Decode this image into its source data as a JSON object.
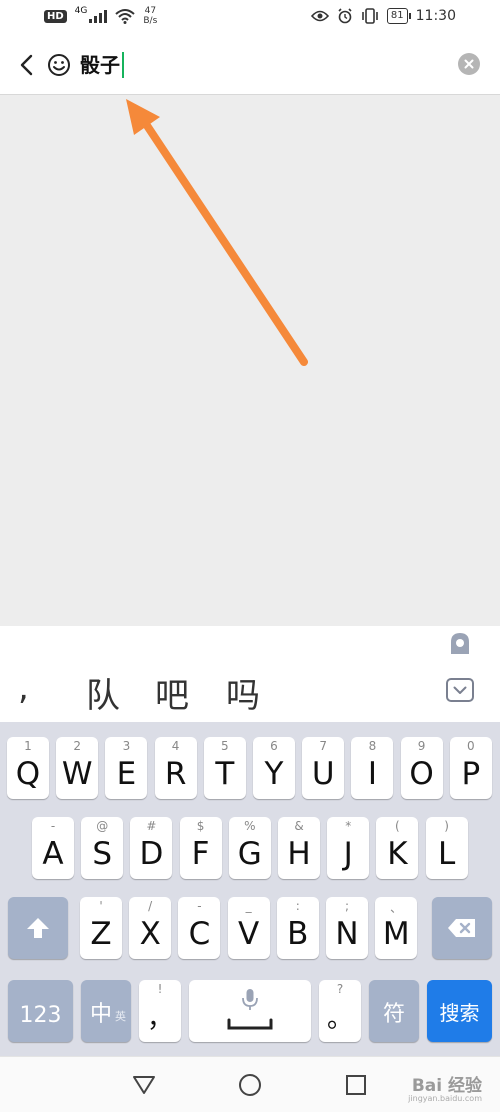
{
  "status_bar": {
    "badge": "HD",
    "network_type": "4G",
    "speed_value": "47",
    "speed_unit": "B/s",
    "battery": "81",
    "time": "11:30",
    "icons": [
      "eye-icon",
      "alarm-icon",
      "vibrate-icon",
      "battery-icon"
    ]
  },
  "search": {
    "query": "骰子",
    "back_icon": "chevron-left-icon",
    "emoji_icon": "smiley-icon",
    "clear_icon": "clear-circle-icon"
  },
  "annotation": {
    "color": "#f5893a"
  },
  "keyboard": {
    "candidates": [
      ",",
      "队",
      "吧",
      "吗"
    ],
    "row1": [
      {
        "key": "Q",
        "hint": "1"
      },
      {
        "key": "W",
        "hint": "2"
      },
      {
        "key": "E",
        "hint": "3"
      },
      {
        "key": "R",
        "hint": "4"
      },
      {
        "key": "T",
        "hint": "5"
      },
      {
        "key": "Y",
        "hint": "6"
      },
      {
        "key": "U",
        "hint": "7"
      },
      {
        "key": "I",
        "hint": "8"
      },
      {
        "key": "O",
        "hint": "9"
      },
      {
        "key": "P",
        "hint": "0"
      }
    ],
    "row2": [
      {
        "key": "A",
        "hint": "-"
      },
      {
        "key": "S",
        "hint": "@"
      },
      {
        "key": "D",
        "hint": "#"
      },
      {
        "key": "F",
        "hint": "$"
      },
      {
        "key": "G",
        "hint": "%"
      },
      {
        "key": "H",
        "hint": "&"
      },
      {
        "key": "J",
        "hint": "*"
      },
      {
        "key": "K",
        "hint": "("
      },
      {
        "key": "L",
        "hint": ")"
      }
    ],
    "row3": [
      {
        "key": "Z",
        "hint": "'"
      },
      {
        "key": "X",
        "hint": "/"
      },
      {
        "key": "C",
        "hint": "-"
      },
      {
        "key": "V",
        "hint": "_"
      },
      {
        "key": "B",
        "hint": ":"
      },
      {
        "key": "N",
        "hint": ";"
      },
      {
        "key": "M",
        "hint": "、"
      }
    ],
    "num_key": "123",
    "lang_key": "中",
    "lang_sub": "英",
    "comma_key": "，",
    "comma_hint": "!",
    "period_key": "。",
    "period_hint": "?",
    "symbol_key": "符",
    "search_key": "搜索",
    "accent": "#1f7ce8",
    "func_color": "#a5b2c9"
  },
  "nav": {
    "icons": [
      "back-triangle-icon",
      "home-circle-icon",
      "recents-square-icon"
    ]
  },
  "watermark": {
    "text": "Bai 经验",
    "sub": "jingyan.baidu.com"
  }
}
